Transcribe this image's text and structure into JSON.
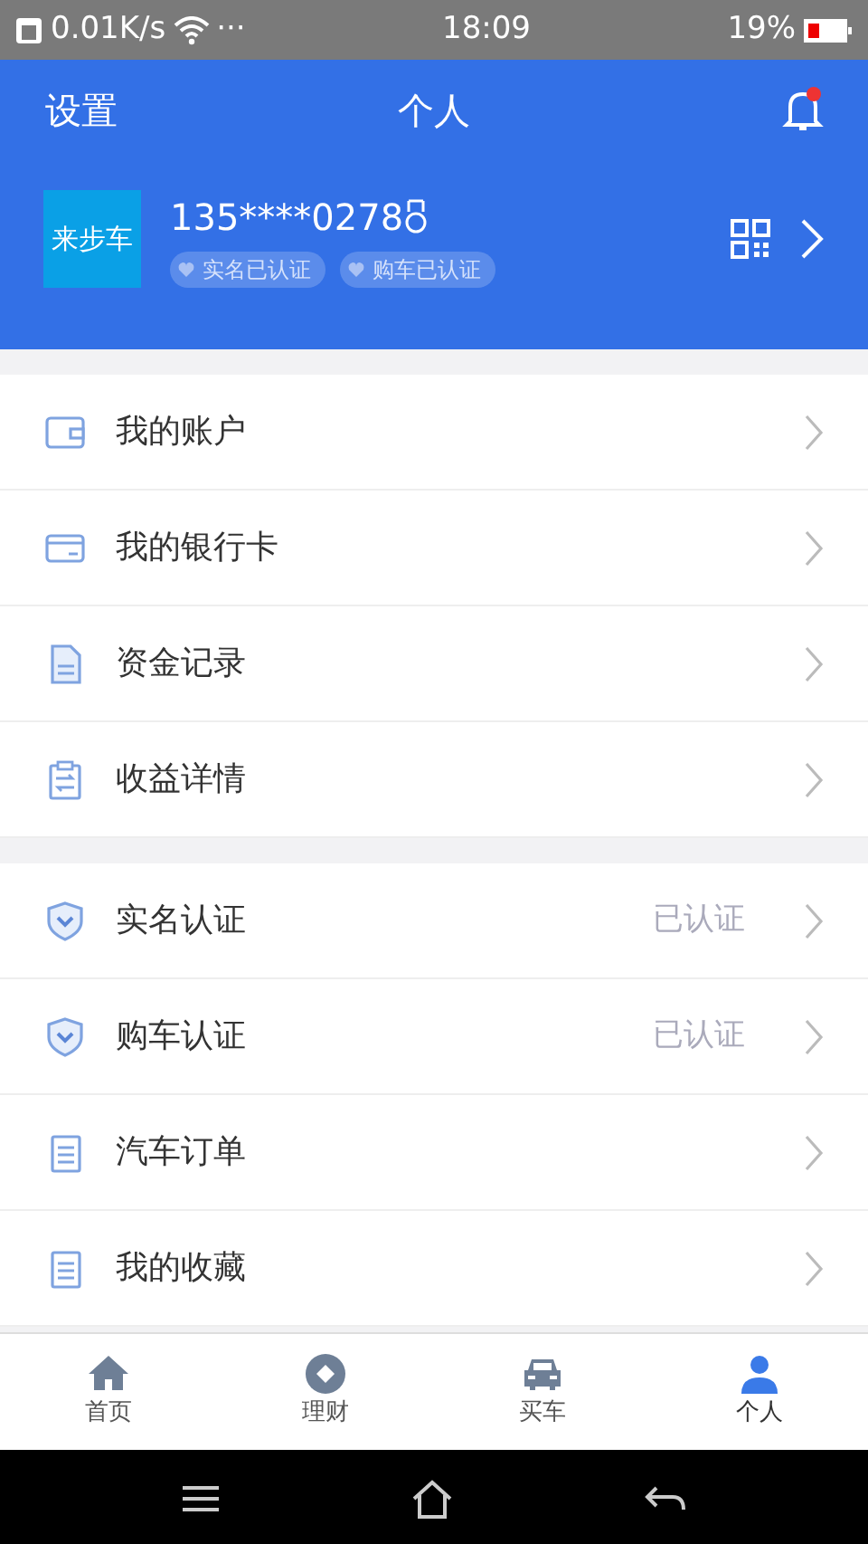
{
  "status_bar": {
    "speed": "0.01K/s",
    "more": "···",
    "time": "18:09",
    "battery": "19%"
  },
  "header": {
    "left": "设置",
    "title": "个人",
    "bell_unread": true
  },
  "profile": {
    "logo": "来步车",
    "phone": "135****0278",
    "badges": [
      "实名已认证",
      "购车已认证"
    ]
  },
  "groups": [
    {
      "items": [
        {
          "kind": "wallet",
          "label": "我的账户"
        },
        {
          "kind": "card",
          "label": "我的银行卡"
        },
        {
          "kind": "record",
          "label": "资金记录"
        },
        {
          "kind": "transfer",
          "label": "收益详情"
        }
      ]
    },
    {
      "items": [
        {
          "kind": "shield",
          "label": "实名认证",
          "status": "已认证"
        },
        {
          "kind": "shield",
          "label": "购车认证",
          "status": "已认证"
        },
        {
          "kind": "list",
          "label": "汽车订单"
        },
        {
          "kind": "list",
          "label": "我的收藏"
        }
      ]
    }
  ],
  "tabs": [
    {
      "kind": "home",
      "label": "首页",
      "selected": false
    },
    {
      "kind": "coin",
      "label": "理财",
      "selected": false
    },
    {
      "kind": "car",
      "label": "买车",
      "selected": false
    },
    {
      "kind": "person",
      "label": "个人",
      "selected": true
    }
  ]
}
